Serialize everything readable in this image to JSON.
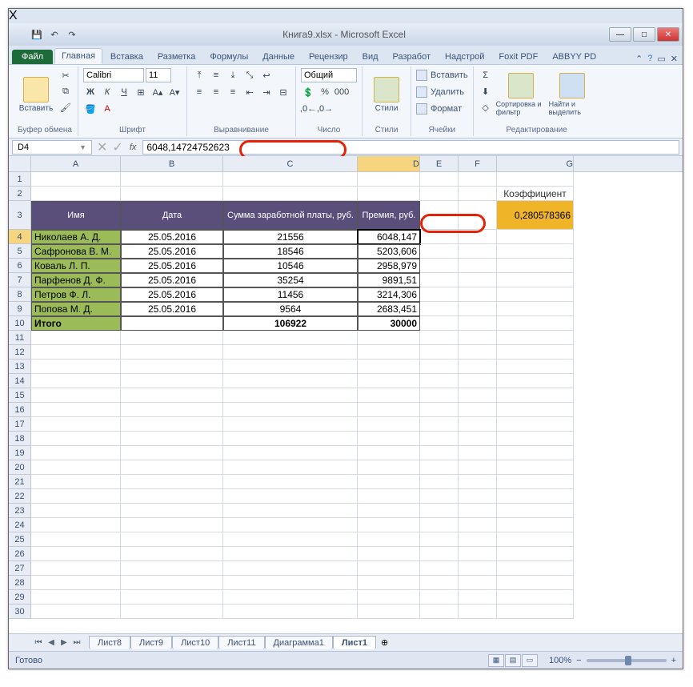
{
  "window": {
    "title": "Книга9.xlsx - Microsoft Excel"
  },
  "qat": {
    "save": "💾",
    "undo": "↶",
    "redo": "↷"
  },
  "tabs": {
    "file": "Файл",
    "items": [
      "Главная",
      "Вставка",
      "Разметка",
      "Формулы",
      "Данные",
      "Рецензир",
      "Вид",
      "Разработ",
      "Надстрой",
      "Foxit PDF",
      "ABBYY PD"
    ],
    "active_index": 0
  },
  "ribbon": {
    "clipboard": {
      "paste": "Вставить",
      "label": "Буфер обмена"
    },
    "font": {
      "name": "Calibri",
      "size": "11",
      "label": "Шрифт"
    },
    "align": {
      "label": "Выравнивание"
    },
    "number": {
      "format": "Общий",
      "label": "Число"
    },
    "styles": {
      "styles": "Стили",
      "label": "Стили"
    },
    "cells": {
      "insert": "Вставить",
      "delete": "Удалить",
      "format": "Формат",
      "label": "Ячейки"
    },
    "editing": {
      "sort": "Сортировка и фильтр",
      "find": "Найти и выделить",
      "label": "Редактирование"
    }
  },
  "formula_bar": {
    "name_box": "D4",
    "fx": "fx",
    "value": "6048,14724752623"
  },
  "columns": [
    "A",
    "B",
    "C",
    "D",
    "E",
    "F",
    "G"
  ],
  "rows_count": 30,
  "selected": {
    "row": 4,
    "col": "D"
  },
  "data": {
    "headers": {
      "A": "Имя",
      "B": "Дата",
      "C": "Сумма заработной платы, руб.",
      "D": "Премия, руб."
    },
    "coef_header": "Коэффициент",
    "coef_value": "0,280578366",
    "rows": [
      {
        "A": "Николаев А. Д.",
        "B": "25.05.2016",
        "C": "21556",
        "D": "6048,147"
      },
      {
        "A": "Сафронова В. М.",
        "B": "25.05.2016",
        "C": "18546",
        "D": "5203,606"
      },
      {
        "A": "Коваль Л. П.",
        "B": "25.05.2016",
        "C": "10546",
        "D": "2958,979"
      },
      {
        "A": "Парфенов Д. Ф.",
        "B": "25.05.2016",
        "C": "35254",
        "D": "9891,51"
      },
      {
        "A": "Петров Ф. Л.",
        "B": "25.05.2016",
        "C": "11456",
        "D": "3214,306"
      },
      {
        "A": "Попова М. Д.",
        "B": "25.05.2016",
        "C": "9564",
        "D": "2683,451"
      }
    ],
    "total": {
      "A": "Итого",
      "C": "106922",
      "D": "30000"
    }
  },
  "sheets": {
    "items": [
      "Лист8",
      "Лист9",
      "Лист10",
      "Лист11",
      "Диаграмма1",
      "Лист1"
    ],
    "active_index": 5
  },
  "status": {
    "ready": "Готово",
    "zoom": "100%"
  }
}
